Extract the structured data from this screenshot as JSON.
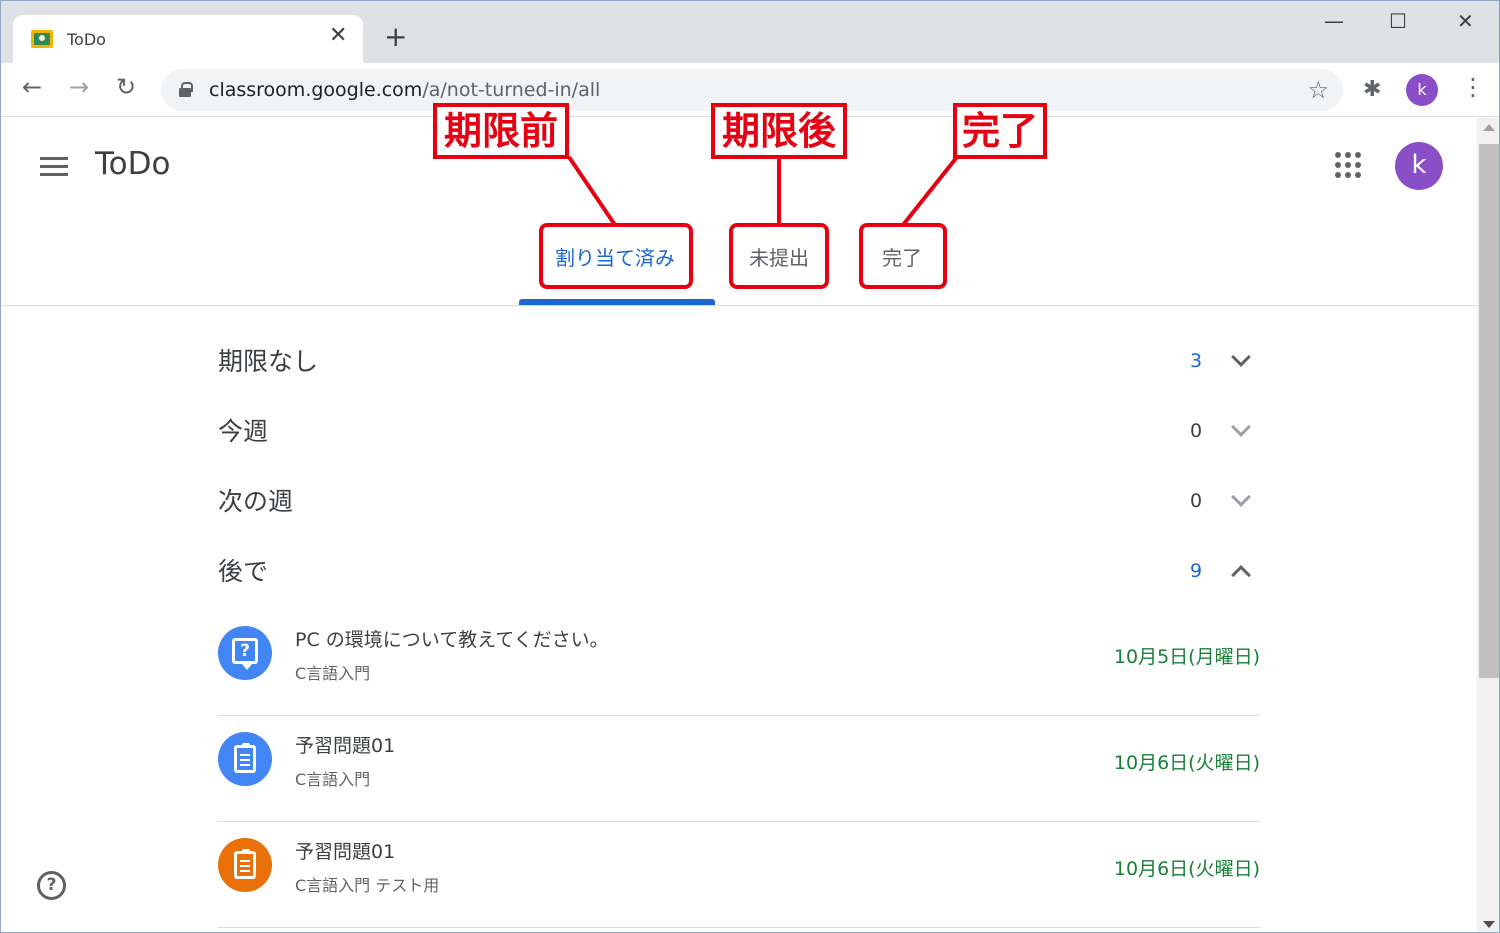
{
  "browser": {
    "tab_title": "ToDo",
    "tab_close": "✕",
    "new_tab": "+",
    "window_minimize": "—",
    "window_maximize": "☐",
    "window_close": "✕",
    "back": "←",
    "forward": "→",
    "reload": "↻",
    "url_host": "classroom.google.com",
    "url_path": "/a/not-turned-in/all",
    "star": "☆",
    "extensions": "✱",
    "profile_initial": "k",
    "menu": "⋮"
  },
  "header": {
    "title": "ToDo",
    "avatar_initial": "k"
  },
  "tabs": [
    {
      "label": "割り当て済み"
    },
    {
      "label": "未提出"
    },
    {
      "label": "完了"
    }
  ],
  "sections": [
    {
      "label": "期限なし",
      "count": "3"
    },
    {
      "label": "今週",
      "count": "0"
    },
    {
      "label": "次の週",
      "count": "0"
    },
    {
      "label": "後で",
      "count": "9"
    }
  ],
  "items": [
    {
      "title": "PC の環境について教えてください。",
      "class": "C言語入門",
      "date": "10月5日(月曜日)",
      "icon": "question-icon",
      "color": "#4285f4"
    },
    {
      "title": "予習問題01",
      "class": "C言語入門",
      "date": "10月6日(火曜日)",
      "icon": "assignment-icon",
      "color": "#4285f4"
    },
    {
      "title": "予習問題01",
      "class": "C言語入門 テスト用",
      "date": "10月6日(火曜日)",
      "icon": "assignment-icon",
      "color": "#e8710a"
    }
  ],
  "help": "?",
  "annotations": [
    {
      "label": "期限前"
    },
    {
      "label": "期限後"
    },
    {
      "label": "完了"
    }
  ],
  "colors": {
    "accent": "#1967d2",
    "date_green": "#188038",
    "annotation_red": "#e60012"
  }
}
